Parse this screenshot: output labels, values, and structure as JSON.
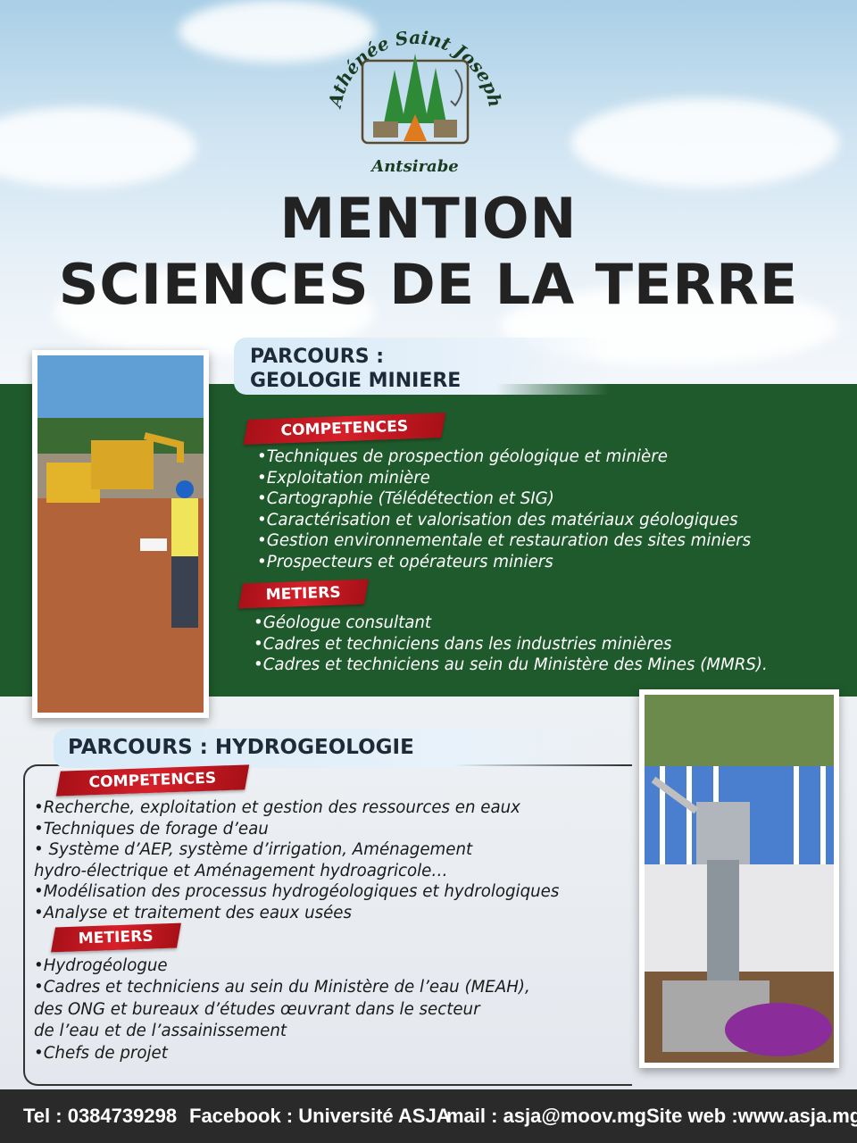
{
  "logo": {
    "arc_text": "Athénée Saint Joseph",
    "city": "Antsirabe"
  },
  "title": {
    "line1": "MENTION",
    "line2": "SCIENCES DE LA TERRE"
  },
  "parcours_geologie": {
    "label_line1": "PARCOURS :",
    "label_line2": "GEOLOGIE MINIERE",
    "competences_label": "COMPETENCES",
    "competences": [
      "•Techniques de prospection géologique et minière",
      "•Exploitation minière",
      "•Cartographie (Télédétection et SIG)",
      "•Caractérisation et valorisation des matériaux géologiques",
      "•Gestion environnementale et restauration des sites miniers",
      "•Prospecteurs et opérateurs miniers"
    ],
    "metiers_label": "METIERS",
    "metiers": [
      "•Géologue consultant",
      "•Cadres et techniciens dans les industries minières",
      "•Cadres et techniciens au sein du Ministère des Mines (MMRS)."
    ]
  },
  "parcours_hydro": {
    "label": "PARCOURS : HYDROGEOLOGIE",
    "competences_label": "COMPETENCES",
    "competences": [
      "•Recherche, exploitation et gestion des ressources en eaux",
      "•Techniques de forage d’eau",
      "• Système d’AEP, système d’irrigation, Aménagement",
      "hydro-électrique et Aménagement hydroagricole…",
      "•Modélisation des processus hydrogéologiques et hydrologiques",
      "•Analyse et traitement des eaux usées"
    ],
    "metiers_label": "METIERS",
    "metiers": [
      "•Hydrogéologue",
      "•Cadres et techniciens au sein du Ministère de l’eau (MEAH),",
      "des ONG  et bureaux d’études œuvrant dans le secteur",
      "de l’eau et de l’assainissement",
      "•Chefs de projet"
    ]
  },
  "footer": {
    "tel": "Tel : 0384739298",
    "facebook": "Facebook : Université ASJA",
    "mail": "mail : asja@moov.mg",
    "site": "Site web :www.asja.mg"
  },
  "colors": {
    "green_band": "#1f5a2c",
    "ribbon_red": "#d6202a",
    "footer_bg": "#2a2a2a",
    "title_text": "#222222"
  }
}
